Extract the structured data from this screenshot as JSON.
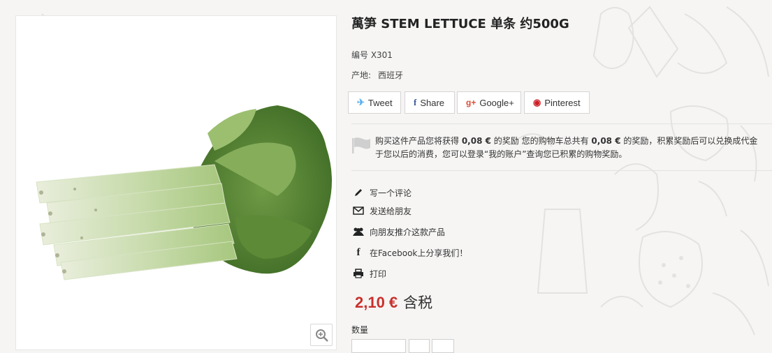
{
  "product": {
    "title": "萬笋 STEM LETTUCE 单条 约500G",
    "reference": "编号 X301",
    "origin_label": "产地:",
    "origin_value": "西班牙"
  },
  "share": {
    "tweet": "Tweet",
    "share": "Share",
    "google": "Google+",
    "pinterest": "Pinterest"
  },
  "loyalty": {
    "text_a": "购买这件产品您将获得 ",
    "points_product": "0,08 €",
    "text_b": " 的奖励 您的购物车总共有 ",
    "points_cart": "0,08 €",
    "text_c": " 的奖励，积累奖励后可以兑换成代金",
    "text_d": "于您以后的消费，您可以登录“我的账户”查询您已积累的购物奖励。"
  },
  "actions": {
    "write_review": "写一个评论",
    "send_friend": "发送给朋友",
    "refer_friend": "向朋友推介这款产品",
    "facebook_share": "在Facebook上分享我们！",
    "print": "打印"
  },
  "price": {
    "amount": "2,10 €",
    "tax_label": "含税"
  },
  "quantity": {
    "label": "数量"
  },
  "colors": {
    "price": "#c9302c",
    "twitter": "#55acee",
    "facebook": "#3b5998",
    "google": "#dd4b39",
    "pinterest": "#cb2027"
  },
  "icons": {
    "zoom": "zoom-in-icon",
    "flag": "flag-icon",
    "pencil": "pencil-icon",
    "envelope": "envelope-icon",
    "users": "users-icon",
    "facebook": "facebook-icon",
    "print": "print-icon"
  }
}
